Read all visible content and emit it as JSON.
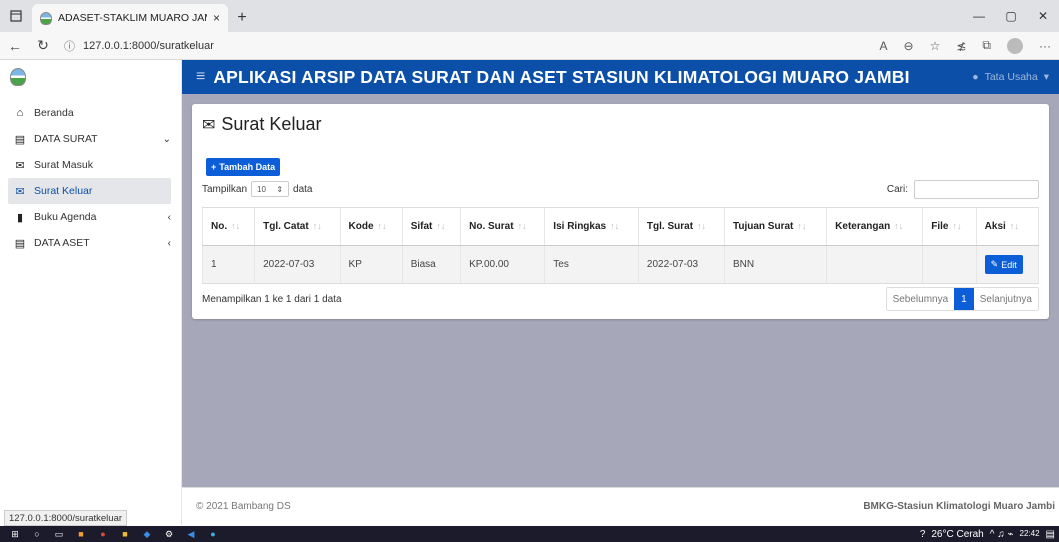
{
  "browser": {
    "tab_title": "ADASET-STAKLIM MUARO JAMBI",
    "tab_close": "×",
    "new_tab": "+",
    "url": "127.0.0.1:8000/suratkeluar",
    "status_url": "127.0.0.1:8000/suratkeluar"
  },
  "app": {
    "title": "APLIKASI ARSIP DATA SURAT DAN ASET STASIUN KLIMATOLOGI MUARO JAMBI",
    "user": "Tata Usaha",
    "accent": "#0b4fa8",
    "content_bg": "#a6a7b8"
  },
  "sidebar": {
    "items": [
      {
        "label": "Beranda",
        "icon": "home-icon"
      },
      {
        "label": "DATA SURAT",
        "icon": "data-icon"
      },
      {
        "label": "Surat Masuk",
        "icon": "envelope-icon"
      },
      {
        "label": "Surat Keluar",
        "icon": "envelope-open-icon"
      },
      {
        "label": "Buku Agenda",
        "icon": "book-icon"
      },
      {
        "label": "DATA ASET",
        "icon": "data-icon"
      }
    ]
  },
  "page": {
    "title": "Surat Keluar",
    "add_button": "Tambah Data",
    "show_label": "Tampilkan",
    "show_value": "10",
    "data_label": "data",
    "search_label": "Cari:",
    "info": "Menampilkan 1 ke 1 dari 1 data",
    "prev": "Sebelumnya",
    "page_num": "1",
    "next": "Selanjutnya"
  },
  "table": {
    "headers": [
      "No.",
      "Tgl. Catat",
      "Kode",
      "Sifat",
      "No. Surat",
      "Isi Ringkas",
      "Tgl. Surat",
      "Tujuan Surat",
      "Keterangan",
      "File",
      "Aksi"
    ],
    "rows": [
      [
        "1",
        "2022-07-03",
        "KP",
        "Biasa",
        "KP.00.00",
        "Tes",
        "2022-07-03",
        "BNN",
        "",
        ""
      ]
    ],
    "edit_label": "Edit"
  },
  "footer": {
    "copyright": "© 2021 Bambang DS",
    "org": "BMKG-Stasiun Klimatologi Muaro Jambi"
  },
  "taskbar": {
    "weather": "26°C  Cerah",
    "time": "22:42"
  }
}
